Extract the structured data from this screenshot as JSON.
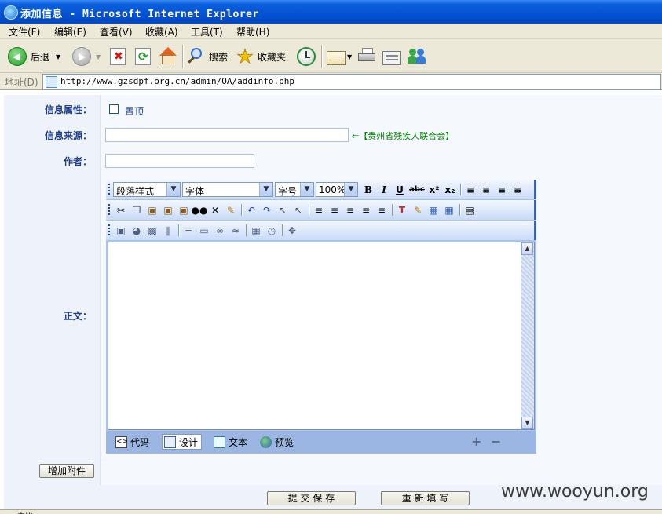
{
  "window": {
    "title": "添加信息 - Microsoft Internet Explorer"
  },
  "menubar": {
    "items": [
      "文件(F)",
      "编辑(E)",
      "查看(V)",
      "收藏(A)",
      "工具(T)",
      "帮助(H)"
    ]
  },
  "toolbar": {
    "back_label": "后退",
    "search_label": "搜索",
    "favorites_label": "收藏夹"
  },
  "address": {
    "label": "地址(D)",
    "url": "http://www.gzsdpf.org.cn/admin/OA/addinfo.php"
  },
  "form": {
    "attribute_label": "信息属性：",
    "pin_label": "置顶",
    "pin_checked": false,
    "source_label": "信息来源：",
    "source_value": "",
    "source_hint": "⇐【贵州省残疾人联合会】",
    "author_label": "作者：",
    "author_value": "",
    "body_label": "正文：",
    "attach_button": "增加附件",
    "submit_button": "提 交 保 存",
    "reset_button": "重 新 填 写"
  },
  "editor": {
    "paragraph_style": "段落样式",
    "font_family": "字体",
    "font_size": "字号",
    "zoom": "100%",
    "mode_tabs": [
      "代码",
      "设计",
      "文本",
      "预览"
    ],
    "active_mode": "设计"
  },
  "watermark": "www.wooyun.org",
  "status": {
    "text": "完毕"
  },
  "colors": {
    "label_text": "#1f3f86",
    "hint_text": "#008000",
    "label_bg": "#eef3fb",
    "editor_bar": "#3a62b5"
  }
}
